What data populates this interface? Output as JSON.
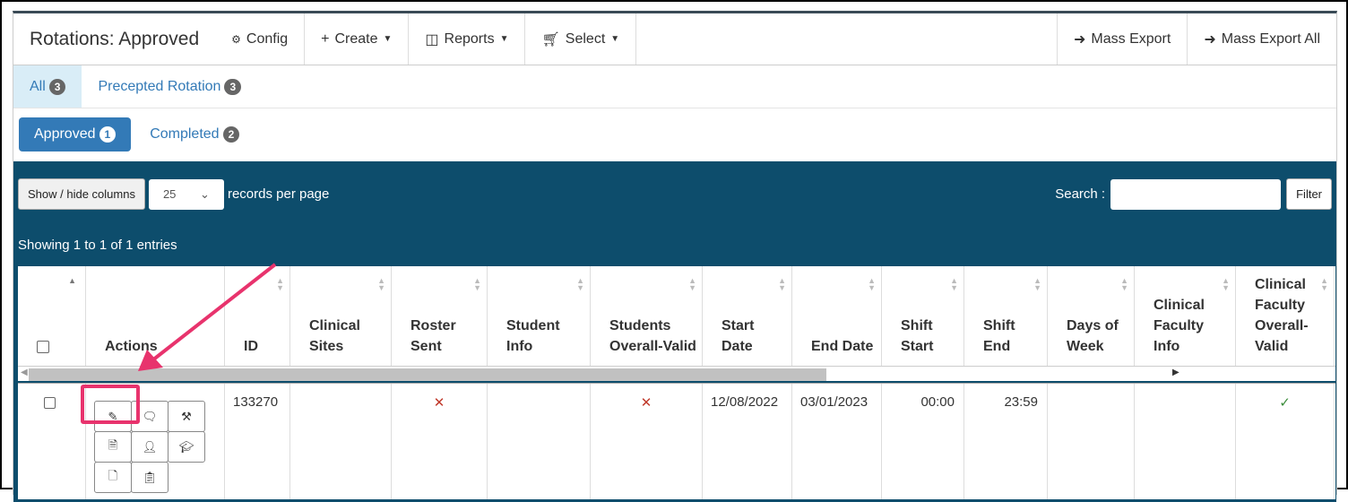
{
  "header": {
    "title": "Rotations: Approved",
    "config": "Config",
    "create": "Create",
    "reports": "Reports",
    "select": "Select",
    "mass_export": "Mass Export",
    "mass_export_all": "Mass Export All"
  },
  "tabs": [
    {
      "label": "All",
      "count": "3"
    },
    {
      "label": "Precepted Rotation",
      "count": "3"
    }
  ],
  "subtabs": [
    {
      "label": "Approved",
      "count": "1"
    },
    {
      "label": "Completed",
      "count": "2"
    }
  ],
  "controls": {
    "show_hide": "Show / hide columns",
    "per_page": "25",
    "per_page_label": "records per page",
    "search_label": "Search :",
    "search_value": "",
    "filter": "Filter",
    "showing": "Showing 1 to 1 of 1 entries"
  },
  "columns": [
    "",
    "Actions",
    "ID",
    "Clinical Sites",
    "Roster Sent",
    "Student Info",
    "Students Overall-Valid",
    "Start Date",
    "End Date",
    "Shift Start",
    "Shift End",
    "Days of Week",
    "Clinical Faculty Info",
    "Clinical Faculty Overall-Valid"
  ],
  "row": {
    "id": "133270",
    "clinical_sites": "",
    "roster_sent": "✕",
    "student_info": "",
    "students_valid": "✕",
    "start_date": "12/08/2022",
    "end_date": "03/01/2023",
    "shift_start": "00:00",
    "shift_end": "23:59",
    "days": "",
    "faculty_info": "",
    "faculty_valid": "✓"
  },
  "actions": [
    "pencil-icon",
    "comments-icon",
    "gavel-icon",
    "excel-file-icon",
    "user-icon",
    "graduate-icon",
    "file-icon",
    "clipboard-icon"
  ],
  "colors": {
    "panel": "#0d4d6c",
    "accent": "#337ab7",
    "annotation": "#e8336d",
    "cross": "#c0392b",
    "check": "#3c8d3c"
  }
}
